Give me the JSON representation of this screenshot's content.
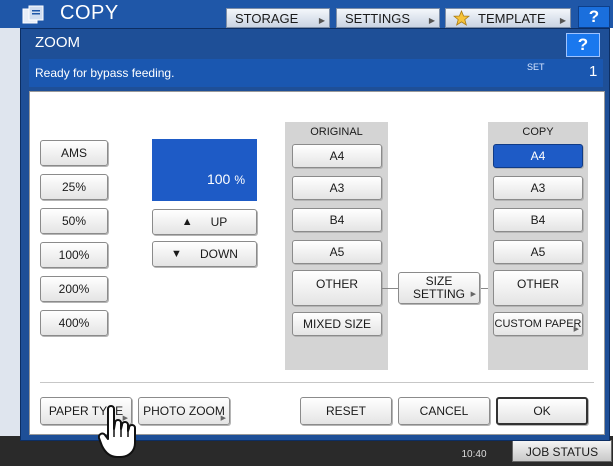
{
  "background": {
    "app_title": "COPY",
    "tabs": [
      {
        "label": "STORAGE"
      },
      {
        "label": "SETTINGS"
      },
      {
        "label": "TEMPLATE"
      }
    ],
    "help_label": "?",
    "clock": "10:40",
    "job_status_label": "JOB STATUS"
  },
  "dialog": {
    "title": "ZOOM",
    "help_label": "?",
    "status_message": "Ready for bypass feeding.",
    "set_label": "SET",
    "set_value": "1"
  },
  "zoom": {
    "presets": [
      {
        "label": "AMS"
      },
      {
        "label": "25%"
      },
      {
        "label": "50%"
      },
      {
        "label": "100%"
      },
      {
        "label": "200%"
      },
      {
        "label": "400%"
      }
    ],
    "value": "100",
    "unit": "%",
    "up_label": "UP",
    "down_label": "DOWN"
  },
  "original": {
    "heading": "ORIGINAL",
    "sizes": [
      {
        "label": "A4"
      },
      {
        "label": "A3"
      },
      {
        "label": "B4"
      },
      {
        "label": "A5"
      }
    ],
    "other_label": "OTHER",
    "mixed_label": "MIXED SIZE"
  },
  "size_setting": {
    "line1": "SIZE",
    "line2": "SETTING"
  },
  "copy": {
    "heading": "COPY",
    "selected": "A4",
    "sizes": [
      {
        "label": "A4"
      },
      {
        "label": "A3"
      },
      {
        "label": "B4"
      },
      {
        "label": "A5"
      }
    ],
    "other_label": "OTHER",
    "custom_label": "CUSTOM PAPER"
  },
  "footer": {
    "paper_type_label": "PAPER TYPE",
    "photo_zoom_label": "PHOTO ZOOM",
    "reset_label": "RESET",
    "cancel_label": "CANCEL",
    "ok_label": "OK"
  },
  "colors": {
    "title_bar": "#1e4f97",
    "status_bar": "#1a57b0",
    "selected": "#1e5bc6"
  },
  "icons": [
    "copy-app-icon",
    "star-icon",
    "up-triangle-icon",
    "down-triangle-icon",
    "pointing-hand-cursor"
  ]
}
